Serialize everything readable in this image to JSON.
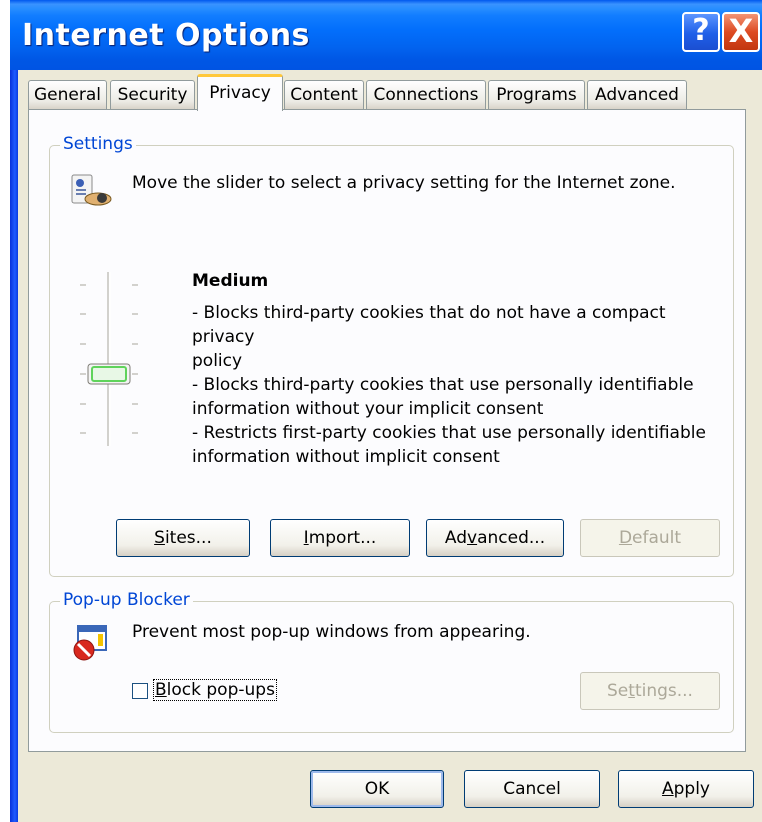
{
  "window": {
    "title": "Internet Options",
    "help_label": "?",
    "close_label": "X"
  },
  "tabs": [
    {
      "label": "General"
    },
    {
      "label": "Security"
    },
    {
      "label": "Privacy",
      "active": true
    },
    {
      "label": "Content"
    },
    {
      "label": "Connections"
    },
    {
      "label": "Programs"
    },
    {
      "label": "Advanced"
    }
  ],
  "settings": {
    "group_label": "Settings",
    "instruction": "Move the slider to select a privacy setting for the Internet zone.",
    "slider": {
      "positions": 6,
      "selected_index_from_top": 3,
      "level_name": "Medium"
    },
    "description_lines": [
      "- Blocks third-party cookies that do not have a compact privacy",
      "policy",
      "- Blocks third-party cookies that use personally identifiable",
      "information without your implicit consent",
      "- Restricts first-party cookies that use personally identifiable",
      "information without implicit consent"
    ],
    "buttons": {
      "sites": {
        "prefix": "",
        "mnemonic": "S",
        "rest": "ites..."
      },
      "import": {
        "prefix": "",
        "mnemonic": "I",
        "rest": "mport..."
      },
      "advanced": {
        "prefix": "Ad",
        "mnemonic": "v",
        "rest": "anced..."
      },
      "default": {
        "prefix": "",
        "mnemonic": "D",
        "rest": "efault"
      }
    }
  },
  "popup_blocker": {
    "group_label": "Pop-up Blocker",
    "description": "Prevent most pop-up windows from appearing.",
    "checkbox": {
      "mnemonic": "B",
      "rest": "lock pop-ups",
      "checked": false
    },
    "settings_button": {
      "prefix": "Se",
      "mnemonic": "t",
      "rest": "tings..."
    }
  },
  "footer": {
    "ok": "OK",
    "cancel": "Cancel",
    "apply": {
      "prefix": "",
      "mnemonic": "A",
      "rest": "pply"
    }
  },
  "colors": {
    "titlebar": "#0054e3",
    "group_label": "#0046d5",
    "active_tab_highlight": "#ffc83c",
    "slider_thumb": "#5fd35b"
  }
}
